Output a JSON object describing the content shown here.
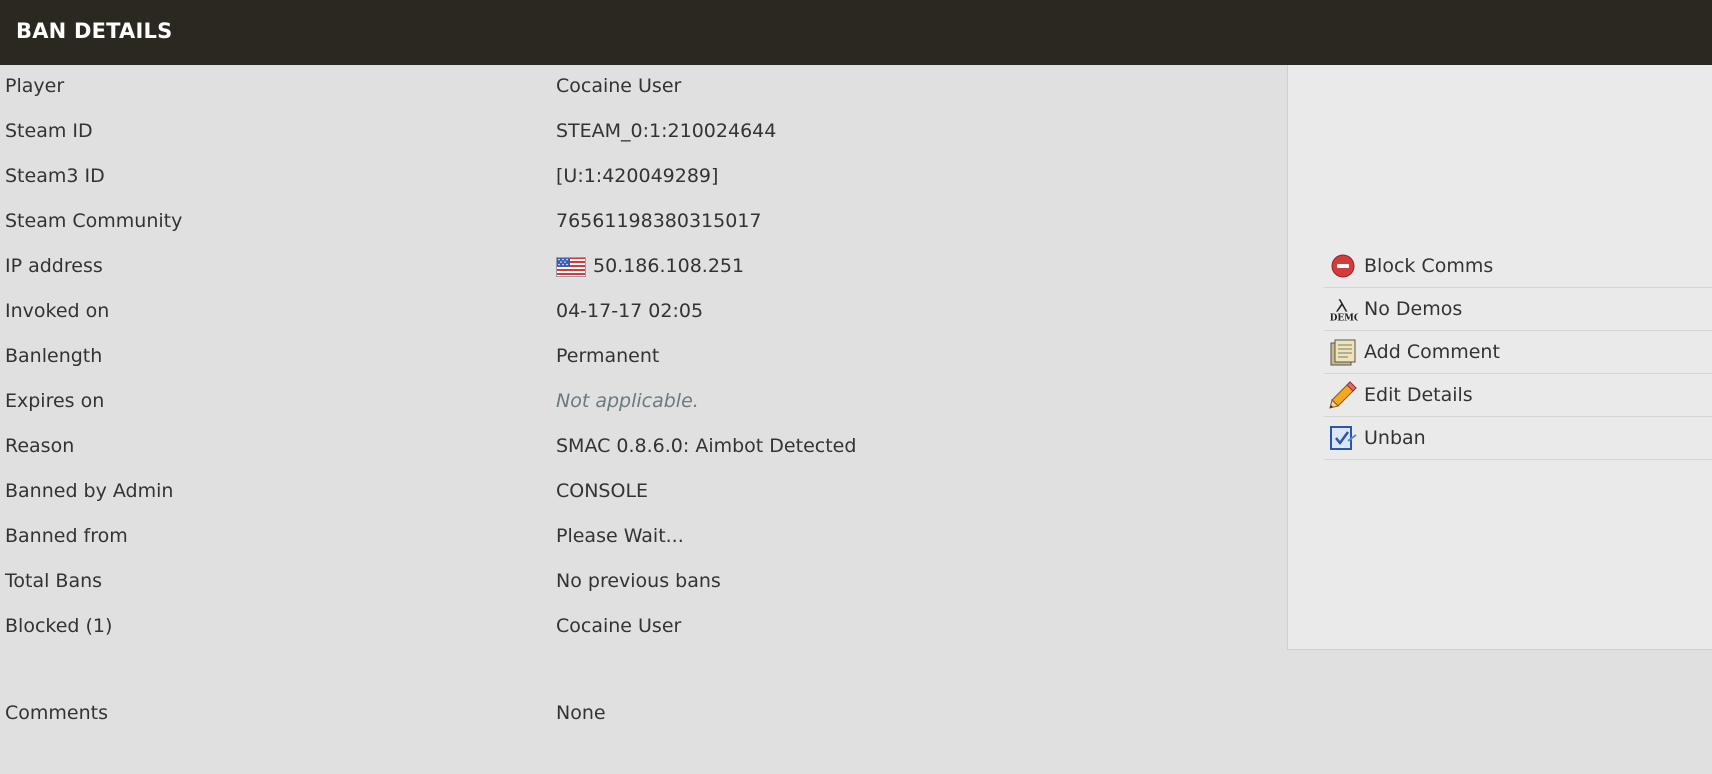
{
  "header": {
    "title": "BAN DETAILS"
  },
  "details": [
    {
      "label": "Player",
      "value": "Cocaine User"
    },
    {
      "label": "Steam ID",
      "value": "STEAM_0:1:210024644"
    },
    {
      "label": "Steam3 ID",
      "value": "[U:1:420049289]"
    },
    {
      "label": "Steam Community",
      "value": "76561198380315017"
    },
    {
      "label": "IP address",
      "value": "50.186.108.251",
      "flag_icon": "us-flag-icon"
    },
    {
      "label": "Invoked on",
      "value": "04-17-17 02:05"
    },
    {
      "label": "Banlength",
      "value": "Permanent"
    },
    {
      "label": "Expires on",
      "value": "Not applicable."
    },
    {
      "label": "Reason",
      "value": "SMAC 0.8.6.0: Aimbot Detected"
    },
    {
      "label": "Banned by Admin",
      "value": "CONSOLE"
    },
    {
      "label": "Banned from",
      "value": "Please Wait..."
    },
    {
      "label": "Total Bans",
      "value": "No previous bans"
    },
    {
      "label": "Blocked (1)",
      "value": "Cocaine User"
    },
    {
      "label": "Comments",
      "value": "None"
    }
  ],
  "sidebar": {
    "actions": [
      {
        "label": "Block Comms",
        "icon": "block-icon"
      },
      {
        "label": "No Demos",
        "icon": "demo-icon"
      },
      {
        "label": "Add Comment",
        "icon": "comment-icon"
      },
      {
        "label": "Edit Details",
        "icon": "pencil-icon"
      },
      {
        "label": "Unban",
        "icon": "unban-icon"
      }
    ]
  },
  "colors": {
    "header_bg": "#2b2721",
    "page_bg": "#e0e0e0",
    "sidebar_bg": "#e9eae9",
    "muted_text": "#6b7a80"
  }
}
